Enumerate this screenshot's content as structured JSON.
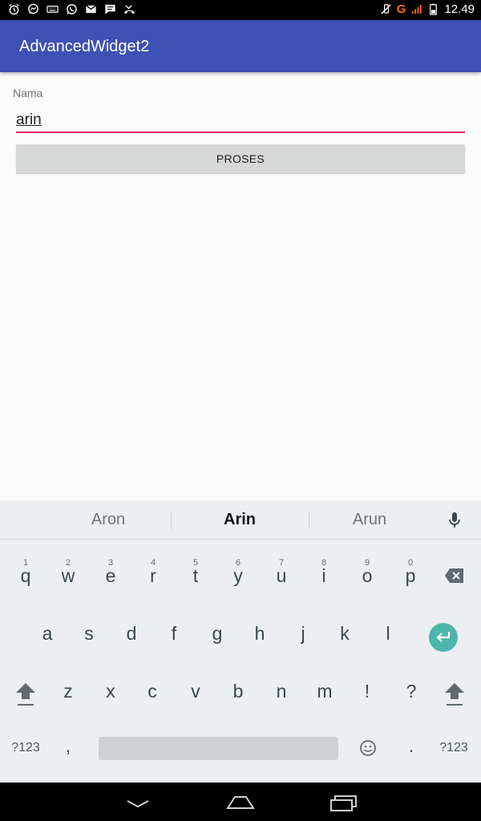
{
  "app": {
    "title": "AdvancedWidget2"
  },
  "status_bar": {
    "time": "12.49",
    "network": "G",
    "left_icons": [
      "alarm-icon",
      "messenger-icon",
      "keyboard-icon",
      "whatsapp-icon",
      "gmail-icon",
      "sms-icon",
      "missed-call-icon"
    ],
    "right_icons": [
      "mute-icon",
      "signal-icon",
      "battery-icon"
    ]
  },
  "form": {
    "label": "Nama",
    "input_value": "arin",
    "button_label": "PROSES",
    "accent_color": "#e91e63"
  },
  "keyboard": {
    "suggestions": [
      "Aron",
      "Arin",
      "Arun"
    ],
    "row1": [
      {
        "key": "q",
        "hint": "1"
      },
      {
        "key": "w",
        "hint": "2"
      },
      {
        "key": "e",
        "hint": "3"
      },
      {
        "key": "r",
        "hint": "4"
      },
      {
        "key": "t",
        "hint": "5"
      },
      {
        "key": "y",
        "hint": "6"
      },
      {
        "key": "u",
        "hint": "7"
      },
      {
        "key": "i",
        "hint": "8"
      },
      {
        "key": "o",
        "hint": "9"
      },
      {
        "key": "p",
        "hint": "0"
      }
    ],
    "row2": [
      "a",
      "s",
      "d",
      "f",
      "g",
      "h",
      "j",
      "k",
      "l"
    ],
    "row3": [
      "z",
      "x",
      "c",
      "v",
      "b",
      "n",
      "m",
      "!",
      "?"
    ],
    "row4": {
      "symbols_left": "?123",
      "comma": ",",
      "period": ".",
      "symbols_right": "?123"
    }
  },
  "colors": {
    "app_bar": "#3f51b5",
    "enter_key": "#4cb6ac"
  }
}
